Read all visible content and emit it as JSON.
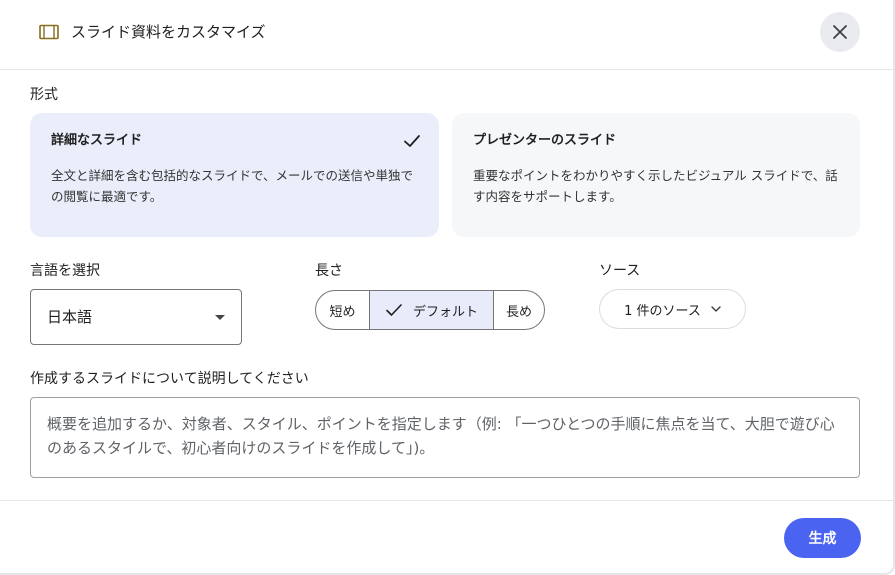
{
  "header": {
    "title": "スライド資料をカスタマイズ",
    "icon": "slides-icon"
  },
  "format": {
    "label": "形式",
    "options": [
      {
        "title": "詳細なスライド",
        "description": "全文と詳細を含む包括的なスライドで、メールでの送信や単独での閲覧に最適です。",
        "selected": true
      },
      {
        "title": "プレゼンターのスライド",
        "description": "重要なポイントをわかりやすく示したビジュアル スライドで、話す内容をサポートします。",
        "selected": false
      }
    ]
  },
  "language": {
    "label": "言語を選択",
    "value": "日本語"
  },
  "length": {
    "label": "長さ",
    "options": [
      "短め",
      "デフォルト",
      "長め"
    ],
    "selected": "デフォルト"
  },
  "source": {
    "label": "ソース",
    "button": "1 件のソース"
  },
  "description": {
    "label": "作成するスライドについて説明してください",
    "placeholder": "概要を追加するか、対象者、スタイル、ポイントを指定します（例: 「一つひとつの手順に焦点を当て、大胆で遊び心のあるスタイルで、初心者向けのスライドを作成して」)。"
  },
  "footer": {
    "generate_label": "生成"
  },
  "colors": {
    "accent": "#4a63f0",
    "selected_card": "#eaeefb",
    "unselected_card": "#f6f7f9"
  }
}
